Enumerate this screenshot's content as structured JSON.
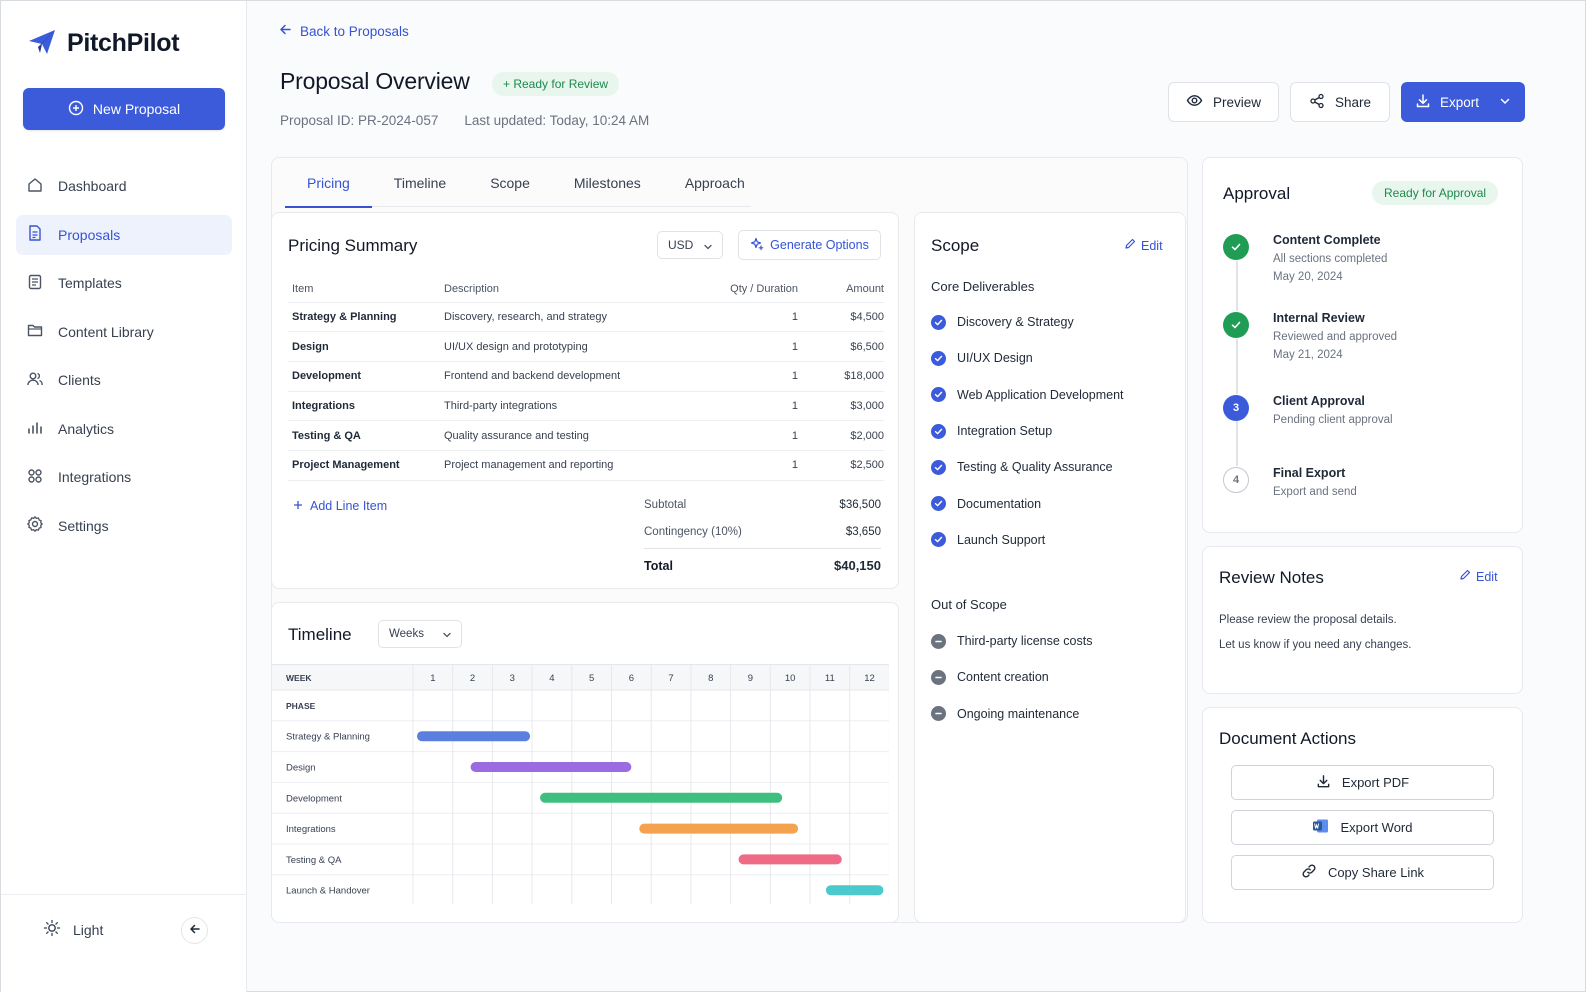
{
  "app": {
    "name": "PitchPilot"
  },
  "sidebar": {
    "new_button": "New Proposal",
    "items": [
      {
        "label": "Dashboard",
        "icon": "home-icon"
      },
      {
        "label": "Proposals",
        "icon": "document-icon",
        "active": true
      },
      {
        "label": "Templates",
        "icon": "template-icon"
      },
      {
        "label": "Content Library",
        "icon": "folder-icon"
      },
      {
        "label": "Clients",
        "icon": "users-icon"
      },
      {
        "label": "Analytics",
        "icon": "bar-chart-icon"
      },
      {
        "label": "Integrations",
        "icon": "grid-icon"
      },
      {
        "label": "Settings",
        "icon": "gear-icon"
      }
    ],
    "theme_label": "Light"
  },
  "header": {
    "back_label": "Back to Proposals",
    "title": "Proposal Overview",
    "status": "+ Ready for Review",
    "proposal_id": "Proposal ID: PR-2024-057",
    "last_updated": "Last updated: Today, 10:24 AM",
    "preview_label": "Preview",
    "share_label": "Share",
    "export_label": "Export"
  },
  "tabs": [
    "Pricing",
    "Timeline",
    "Scope",
    "Milestones",
    "Approach"
  ],
  "pricing": {
    "title": "Pricing Summary",
    "currency": "USD",
    "generate_label": "Generate Options",
    "columns": [
      "Item",
      "Description",
      "Qty / Duration",
      "Amount"
    ],
    "rows": [
      [
        "Strategy & Planning",
        "Discovery, research, and strategy",
        "1",
        "$4,500"
      ],
      [
        "Design",
        "UI/UX design and prototyping",
        "1",
        "$6,500"
      ],
      [
        "Development",
        "Frontend and backend development",
        "1",
        "$18,000"
      ],
      [
        "Integrations",
        "Third-party integrations",
        "1",
        "$3,000"
      ],
      [
        "Testing & QA",
        "Quality assurance and testing",
        "1",
        "$2,000"
      ],
      [
        "Project Management",
        "Project management and reporting",
        "1",
        "$2,500"
      ]
    ],
    "add_line_label": "Add Line Item",
    "subtotal_label": "Subtotal",
    "subtotal": "$36,500",
    "contingency_label": "Contingency (10%)",
    "contingency": "$3,650",
    "total_label": "Total",
    "total": "$40,150"
  },
  "timeline": {
    "title": "Timeline",
    "unit": "Weeks",
    "week_header": "WEEK",
    "phase_header": "PHASE",
    "weeks": [
      "1",
      "2",
      "3",
      "4",
      "5",
      "6",
      "7",
      "8",
      "9",
      "10",
      "11",
      "12"
    ],
    "phases": [
      {
        "name": "Strategy & Planning",
        "start": 1.1,
        "end": 3.95,
        "color": "#5b7fe0"
      },
      {
        "name": "Design",
        "start": 2.45,
        "end": 6.5,
        "color": "#9b6be0"
      },
      {
        "name": "Development",
        "start": 4.2,
        "end": 10.3,
        "color": "#3fbf7f"
      },
      {
        "name": "Integrations",
        "start": 6.7,
        "end": 10.7,
        "color": "#f4a24d"
      },
      {
        "name": "Testing & QA",
        "start": 9.2,
        "end": 11.8,
        "color": "#ef6b85"
      },
      {
        "name": "Launch & Handover",
        "start": 11.4,
        "end": 12.85,
        "color": "#4cc9cc"
      }
    ]
  },
  "scope": {
    "title": "Scope",
    "edit_label": "Edit",
    "deliverables_title": "Core Deliverables",
    "deliverables": [
      "Discovery & Strategy",
      "UI/UX Design",
      "Web Application Development",
      "Integration Setup",
      "Testing & Quality Assurance",
      "Documentation",
      "Launch Support"
    ],
    "out_title": "Out of Scope",
    "out": [
      "Third-party license costs",
      "Content creation",
      "Ongoing maintenance"
    ]
  },
  "approval": {
    "title": "Approval",
    "status": "Ready for Approval",
    "steps": [
      {
        "name": "Content Complete",
        "desc": "All sections completed",
        "date": "May 20, 2024",
        "state": "done"
      },
      {
        "name": "Internal Review",
        "desc": "Reviewed and approved",
        "date": "May 21, 2024",
        "state": "done"
      },
      {
        "name": "Client Approval",
        "desc": "Pending client approval",
        "num": "3",
        "state": "current"
      },
      {
        "name": "Final Export",
        "desc": "Export and send",
        "num": "4",
        "state": "todo"
      }
    ]
  },
  "notes": {
    "title": "Review Notes",
    "edit_label": "Edit",
    "line1": "Please review the proposal details.",
    "line2": "Let us know if you need any changes."
  },
  "doc_actions": {
    "title": "Document Actions",
    "export_pdf": "Export PDF",
    "export_word": "Export Word",
    "copy_link": "Copy Share Link"
  },
  "colors": {
    "accent": "#3b5bdb",
    "success": "#1f9d55"
  }
}
